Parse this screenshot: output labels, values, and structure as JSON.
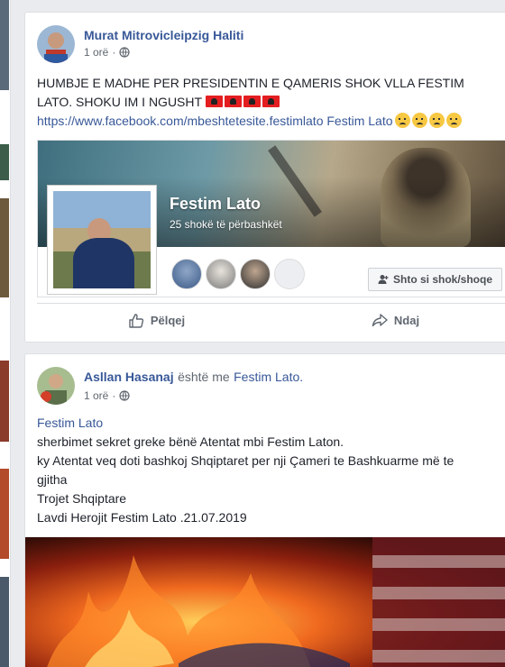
{
  "post1": {
    "author": "Murat Mitrovicleipzig Haliti",
    "time": "1 orë",
    "dot": "·",
    "text_line1": "HUMBJE E MADHE PER PRESIDENTIN E QAMERIS SHOK VLLA FESTIM",
    "text_line2": "LATO. SHOKU IM I NGUSHT",
    "link": "https://www.facebook.com/mbeshtetesite.festimlato",
    "link_suffix": "Festim Lato",
    "profile": {
      "name": "Festim Lato",
      "mutual": "25 shokë të përbashkët",
      "add_button": "Shto si shok/shoqe"
    },
    "actions": {
      "like": "Pëlqej",
      "share": "Ndaj"
    }
  },
  "post2": {
    "author": "Asllan Hasanaj",
    "with_text": "është me",
    "with_person": "Festim Lato.",
    "time": "1 orë",
    "dot": "·",
    "tag": "Festim Lato",
    "line1": "sherbimet sekret greke bënë Atentat mbi Festim Laton.",
    "line2": "ky Atentat veq doti bashkoj Shqiptaret per nji Çameri te Bashkuarme më te",
    "line3": "gjitha",
    "line4": "Trojet Shqiptare",
    "line5": "Lavdi Herojit Festim Lato .21.07.2019"
  },
  "colors": {
    "link": "#385898",
    "flag_red": "#e41e20",
    "background": "#e9ebee"
  },
  "icons": [
    "globe-icon",
    "add-friend-icon",
    "like-icon",
    "share-icon",
    "albanian-flag-icon",
    "crying-face-icon"
  ]
}
